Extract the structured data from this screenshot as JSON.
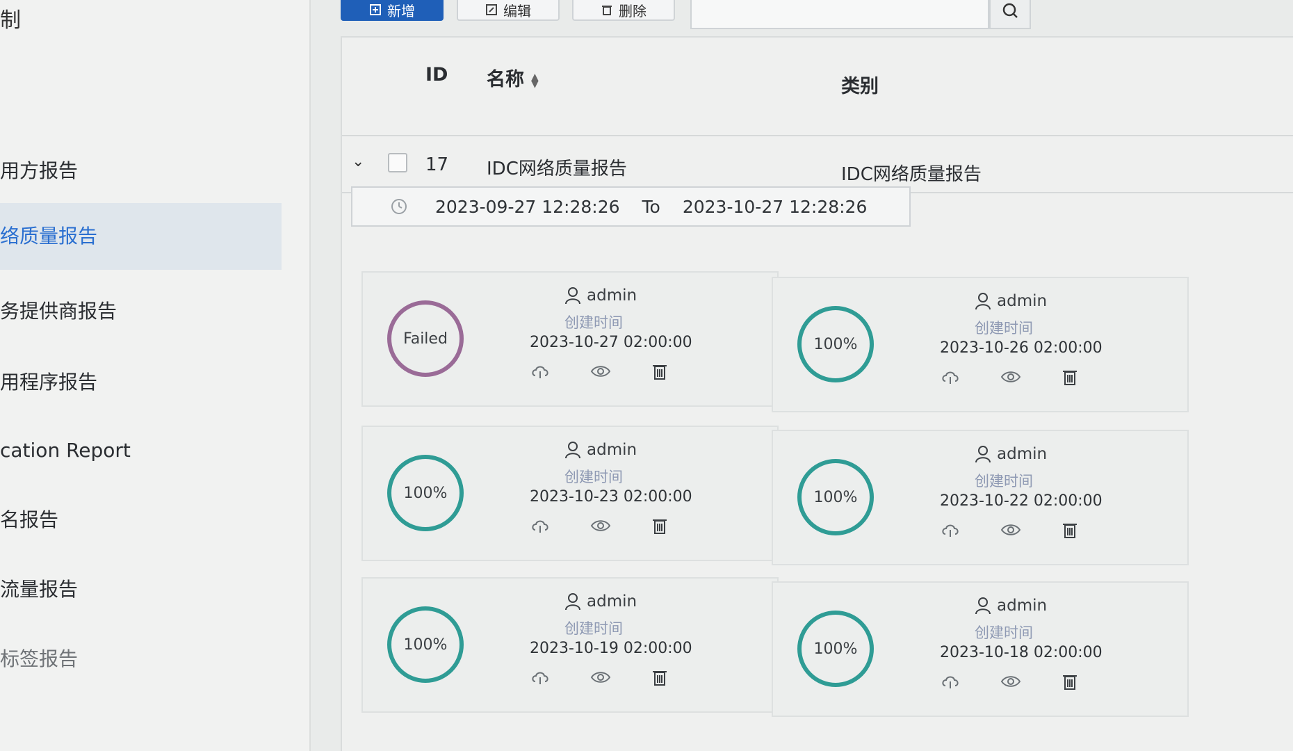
{
  "sidebar": {
    "top_fragment": "制",
    "items": [
      {
        "label": "用方报告",
        "active": false
      },
      {
        "label": "络质量报告",
        "active": true
      },
      {
        "label": "务提供商报告",
        "active": false
      },
      {
        "label": "用程序报告",
        "active": false
      },
      {
        "label": "cation Report",
        "active": false
      },
      {
        "label": "名报告",
        "active": false
      },
      {
        "label": "流量报告",
        "active": false
      },
      {
        "label": "标签报告",
        "active": false
      }
    ]
  },
  "toolbar": {
    "add_label": "新增",
    "edit_label": "编辑",
    "delete_label": "删除",
    "search_value": ""
  },
  "table": {
    "headers": {
      "id": "ID",
      "name": "名称",
      "category": "类别"
    },
    "row": {
      "id": "17",
      "name": "IDC网络质量报告",
      "category": "IDC网络质量报告"
    }
  },
  "date_range": {
    "start": "2023-09-27 12:28:26",
    "to_label": "To",
    "end": "2023-10-27 12:28:26"
  },
  "colors": {
    "ring_ok": "#2f9c95",
    "ring_failed": "#9a6b97",
    "created_label": "#8e99b3",
    "active_menu": "#2a6fd0"
  },
  "cards": [
    {
      "status": "Failed",
      "user": "admin",
      "created_label": "创建时间",
      "created_time": "2023-10-27 02:00:00"
    },
    {
      "status": "100%",
      "user": "admin",
      "created_label": "创建时间",
      "created_time": "2023-10-26 02:00:00"
    },
    {
      "status": "100%",
      "user": "admin",
      "created_label": "创建时间",
      "created_time": "2023-10-23 02:00:00"
    },
    {
      "status": "100%",
      "user": "admin",
      "created_label": "创建时间",
      "created_time": "2023-10-22 02:00:00"
    },
    {
      "status": "100%",
      "user": "admin",
      "created_label": "创建时间",
      "created_time": "2023-10-19 02:00:00"
    },
    {
      "status": "100%",
      "user": "admin",
      "created_label": "创建时间",
      "created_time": "2023-10-18 02:00:00"
    }
  ]
}
